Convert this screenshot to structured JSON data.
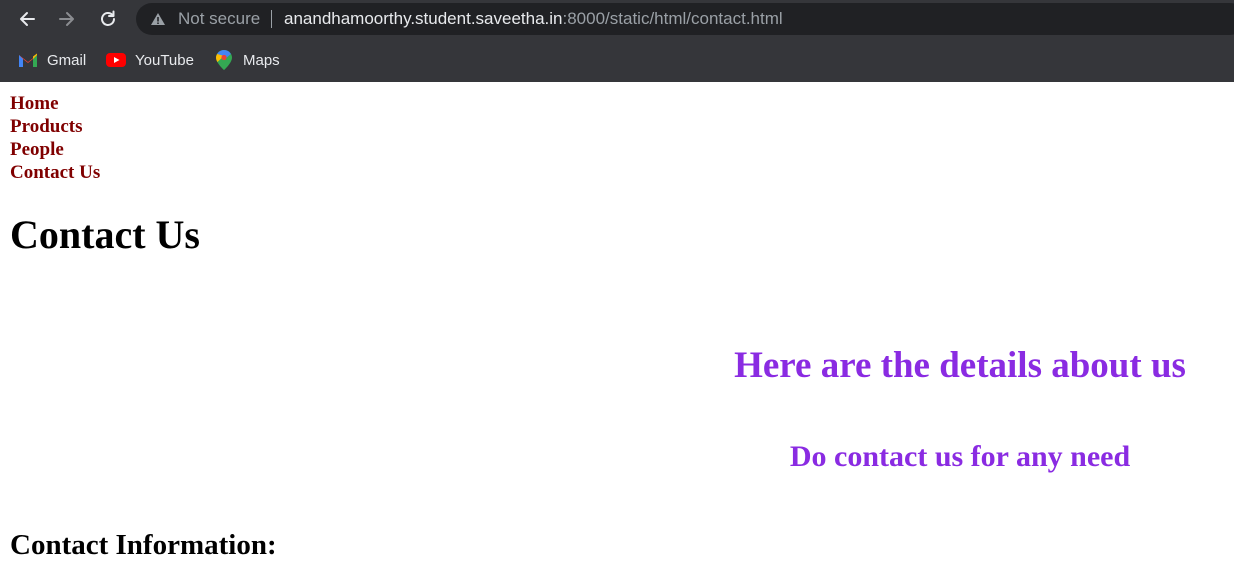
{
  "browser": {
    "not_secure": "Not secure",
    "url_host": "anandhamoorthy.student.saveetha.in",
    "url_rest": ":8000/static/html/contact.html",
    "bookmarks": [
      {
        "label": "Gmail",
        "icon": "gmail-icon"
      },
      {
        "label": "YouTube",
        "icon": "youtube-icon"
      },
      {
        "label": "Maps",
        "icon": "maps-icon"
      }
    ]
  },
  "nav": {
    "items": [
      "Home",
      "Products",
      "People",
      "Contact Us"
    ]
  },
  "page": {
    "title": "Contact Us",
    "details_heading": "Here are the details about us",
    "contact_need": "Do contact us for any need",
    "contact_info_heading": "Contact Information:"
  },
  "colors": {
    "chrome_bg": "#35363a",
    "omnibox_bg": "#202124",
    "nav_link": "#800000",
    "accent_purple": "#8a2be2"
  }
}
